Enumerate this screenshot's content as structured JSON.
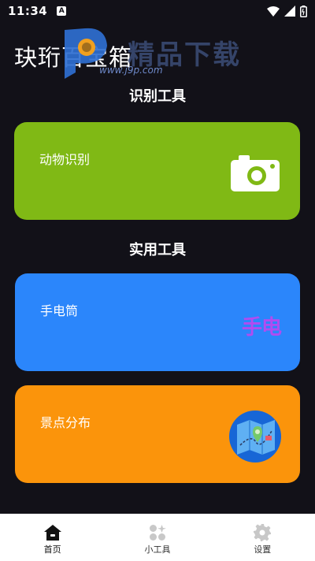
{
  "status_bar": {
    "time": "11:34",
    "app_icon_letter": "A"
  },
  "app": {
    "title": "玦珩百宝箱"
  },
  "watermark": {
    "text": "精品下载",
    "url": "www.j9p.com"
  },
  "sections": [
    {
      "heading": "识别工具"
    },
    {
      "heading": "实用工具"
    }
  ],
  "cards": {
    "animal": {
      "label": "动物识别",
      "color": "#80b915",
      "icon": "camera-icon"
    },
    "flashlight": {
      "label": "手电筒",
      "color": "#2b86fb",
      "graphic_text": "手电"
    },
    "scenic": {
      "label": "景点分布",
      "color": "#fb940b",
      "icon": "map-icon"
    }
  },
  "bottom_nav": {
    "items": [
      {
        "label": "首页",
        "icon": "home-icon",
        "active": true
      },
      {
        "label": "小工具",
        "icon": "tools-grid-icon",
        "active": false
      },
      {
        "label": "设置",
        "icon": "gear-icon",
        "active": false
      }
    ]
  }
}
